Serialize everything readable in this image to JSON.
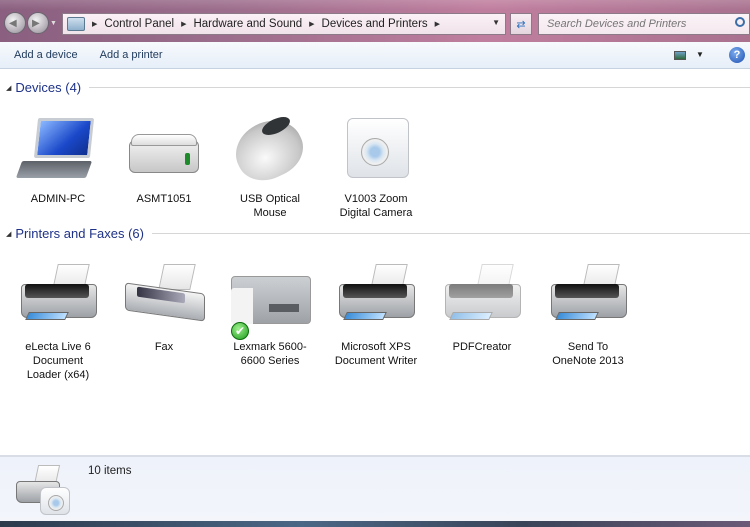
{
  "window": {
    "breadcrumb": [
      "Control Panel",
      "Hardware and Sound",
      "Devices and Printers"
    ],
    "search_placeholder": "Search Devices and Printers"
  },
  "toolbar": {
    "add_device": "Add a device",
    "add_printer": "Add a printer",
    "help_glyph": "?"
  },
  "groups": [
    {
      "title": "Devices (4)",
      "items": [
        {
          "label": "ADMIN-PC",
          "icon": "laptop-icon"
        },
        {
          "label": "ASMT1051",
          "icon": "external-drive-icon"
        },
        {
          "label": "USB Optical Mouse",
          "icon": "mouse-icon"
        },
        {
          "label": "V1003 Zoom Digital Camera",
          "icon": "camera-icon"
        }
      ]
    },
    {
      "title": "Printers and Faxes (6)",
      "items": [
        {
          "label": "eLecta Live 6 Document Loader (x64)",
          "icon": "printer-icon"
        },
        {
          "label": "Fax",
          "icon": "fax-icon"
        },
        {
          "label": "Lexmark 5600-6600 Series",
          "icon": "multifunction-printer-icon",
          "default": true
        },
        {
          "label": "Microsoft XPS Document Writer",
          "icon": "printer-icon"
        },
        {
          "label": "PDFCreator",
          "icon": "printer-icon"
        },
        {
          "label": "Send To OneNote 2013",
          "icon": "printer-icon"
        }
      ]
    }
  ],
  "details": {
    "count": "10 items"
  },
  "icons": {
    "back": "◀",
    "forward": "▶",
    "crumb_sep": "▶",
    "dropdown": "▼",
    "group_toggle": "◢",
    "refresh": "⇄",
    "check": "✔"
  }
}
